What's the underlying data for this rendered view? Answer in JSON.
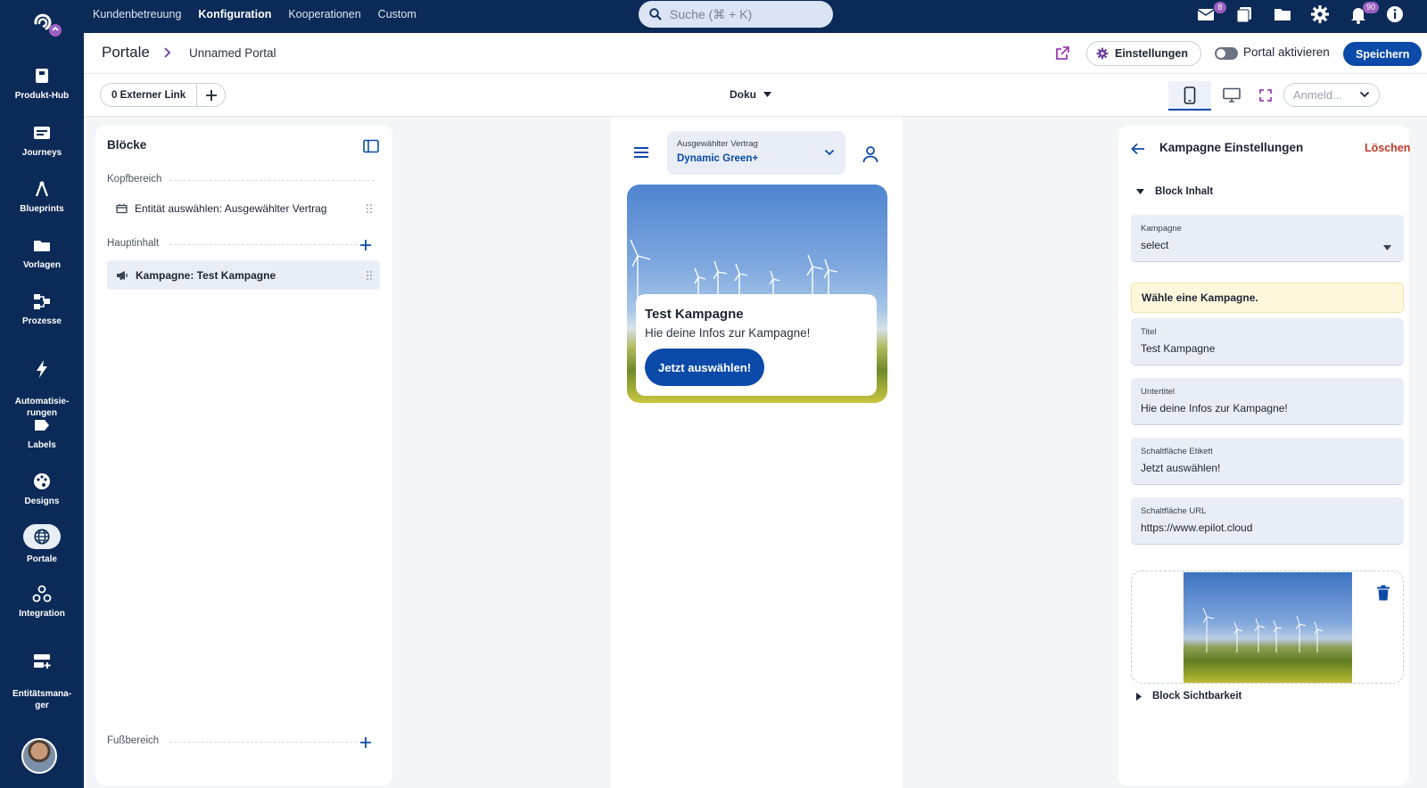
{
  "topnav": {
    "items": [
      {
        "label": "Kundenbetreuung"
      },
      {
        "label": "Konfiguration"
      },
      {
        "label": "Kooperationen"
      },
      {
        "label": "Custom"
      }
    ],
    "search_placeholder": "Suche (⌘ + K)",
    "mail_badge": "8",
    "notifications_badge": "90"
  },
  "sidebar": {
    "items": [
      {
        "label": "Produkt-Hub",
        "icon": "box-icon"
      },
      {
        "label": "Journeys",
        "icon": "journey-icon"
      },
      {
        "label": "Blueprints",
        "icon": "compass-icon"
      },
      {
        "label": "Vorlagen",
        "icon": "folder-icon"
      },
      {
        "label": "Prozesse",
        "icon": "process-icon"
      },
      {
        "label": "Automatisie-\nrungen",
        "icon": "bolt-icon"
      },
      {
        "label": "Labels",
        "icon": "label-icon"
      },
      {
        "label": "Designs",
        "icon": "palette-icon"
      },
      {
        "label": "Portale",
        "icon": "globe-icon"
      },
      {
        "label": "Integration",
        "icon": "webhook-icon"
      },
      {
        "label": "Entitätsmana-\nger",
        "icon": "entity-icon"
      }
    ],
    "active": "Portale"
  },
  "header": {
    "title": "Portale",
    "portal_name": "Unnamed Portal",
    "settings_label": "Einstellungen",
    "activate_label": "Portal aktivieren",
    "save_label": "Speichern"
  },
  "toolbar": {
    "external_link_label": "0 Externer Link",
    "doku_label": "Doku",
    "login_select_value": "Anmeld..."
  },
  "blocks": {
    "title": "Blöcke",
    "sections": {
      "head": "Kopfbereich",
      "main": "Hauptinhalt",
      "footer": "Fußbereich"
    },
    "head_items": [
      "Entität auswählen: Ausgewählter Vertrag"
    ],
    "main_items": [
      "Kampagne: Test Kampagne"
    ]
  },
  "preview": {
    "contract_label": "Ausgewählter Vertrag",
    "contract_value": "Dynamic Green+",
    "card_title": "Test Kampagne",
    "card_subtitle": "Hie deine Infos zur Kampagne!",
    "card_button": "Jetzt auswählen!"
  },
  "settings": {
    "title": "Kampagne Einstellungen",
    "delete_label": "Löschen",
    "block_content_label": "Block Inhalt",
    "block_visibility_label": "Block Sichtbarkeit",
    "warning": "Wähle eine Kampagne.",
    "fields": {
      "campaign": {
        "label": "Kampagne",
        "value": "select"
      },
      "title": {
        "label": "Titel",
        "value": "Test Kampagne"
      },
      "subtitle": {
        "label": "Untertitel",
        "value": "Hie deine Infos zur Kampagne!"
      },
      "button_label": {
        "label": "Schaltfläche Etikett",
        "value": "Jetzt auswählen!"
      },
      "button_url": {
        "label": "Schaltfläche URL",
        "value": "https://www.epilot.cloud"
      }
    }
  },
  "colors": {
    "navy": "#0b2a57",
    "primary": "#0b4aa8",
    "danger": "#c0392b",
    "accent_purple": "#9b5fc0"
  }
}
